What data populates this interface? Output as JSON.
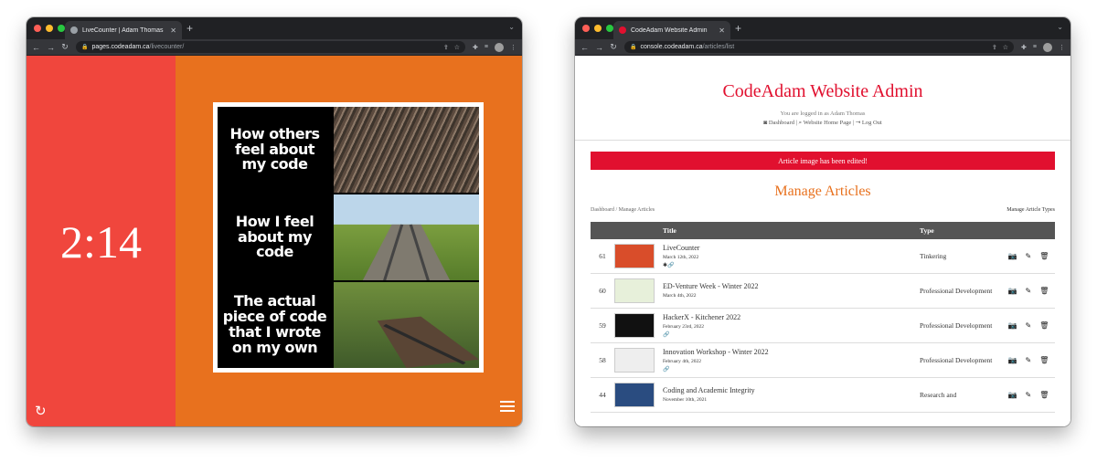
{
  "colors": {
    "red_panel": "#f0463d",
    "orange_panel": "#e8711e",
    "brand_red": "#e1102f"
  },
  "left_window": {
    "tab_title": "LiveCounter | Adam Thomas",
    "url_host": "pages.codeadam.ca",
    "url_path": "/livecounter/",
    "counter": "2:14",
    "meme": {
      "lines": [
        "How others feel about my code",
        "How I feel about my code",
        "The actual piece of code that I wrote on my own"
      ]
    }
  },
  "right_window": {
    "tab_title": "CodeAdam Website Admin",
    "url_host": "console.codeadam.ca",
    "url_path": "/articles/list",
    "site_title": "CodeAdam Website Admin",
    "logged_in": "You are logged in as Adam Thomas",
    "links": [
      "Dashboard",
      "Website Home Page",
      "Log Out"
    ],
    "alert": "Article image has been edited!",
    "section_title": "Manage Articles",
    "breadcrumb": "Dashboard / Manage Articles",
    "manage_types": "Manage Article Types",
    "columns": [
      "",
      "",
      "Title",
      "Type",
      ""
    ],
    "rows": [
      {
        "id": "61",
        "title": "LiveCounter",
        "date": "March 12th, 2022",
        "type": "Tinkering",
        "icons": "✱🔗"
      },
      {
        "id": "60",
        "title": "ED-Venture Week - Winter 2022",
        "date": "March 4th, 2022",
        "type": "Professional Development",
        "icons": ""
      },
      {
        "id": "59",
        "title": "HackerX - Kitchener 2022",
        "date": "February 23rd, 2022",
        "type": "Professional Development",
        "icons": "🔗"
      },
      {
        "id": "58",
        "title": "Innovation Workshop - Winter 2022",
        "date": "February 4th, 2022",
        "type": "Professional Development",
        "icons": "🔗"
      },
      {
        "id": "44",
        "title": "Coding and Academic Integrity",
        "date": "November 10th, 2021",
        "type": "Research and",
        "icons": ""
      }
    ]
  }
}
